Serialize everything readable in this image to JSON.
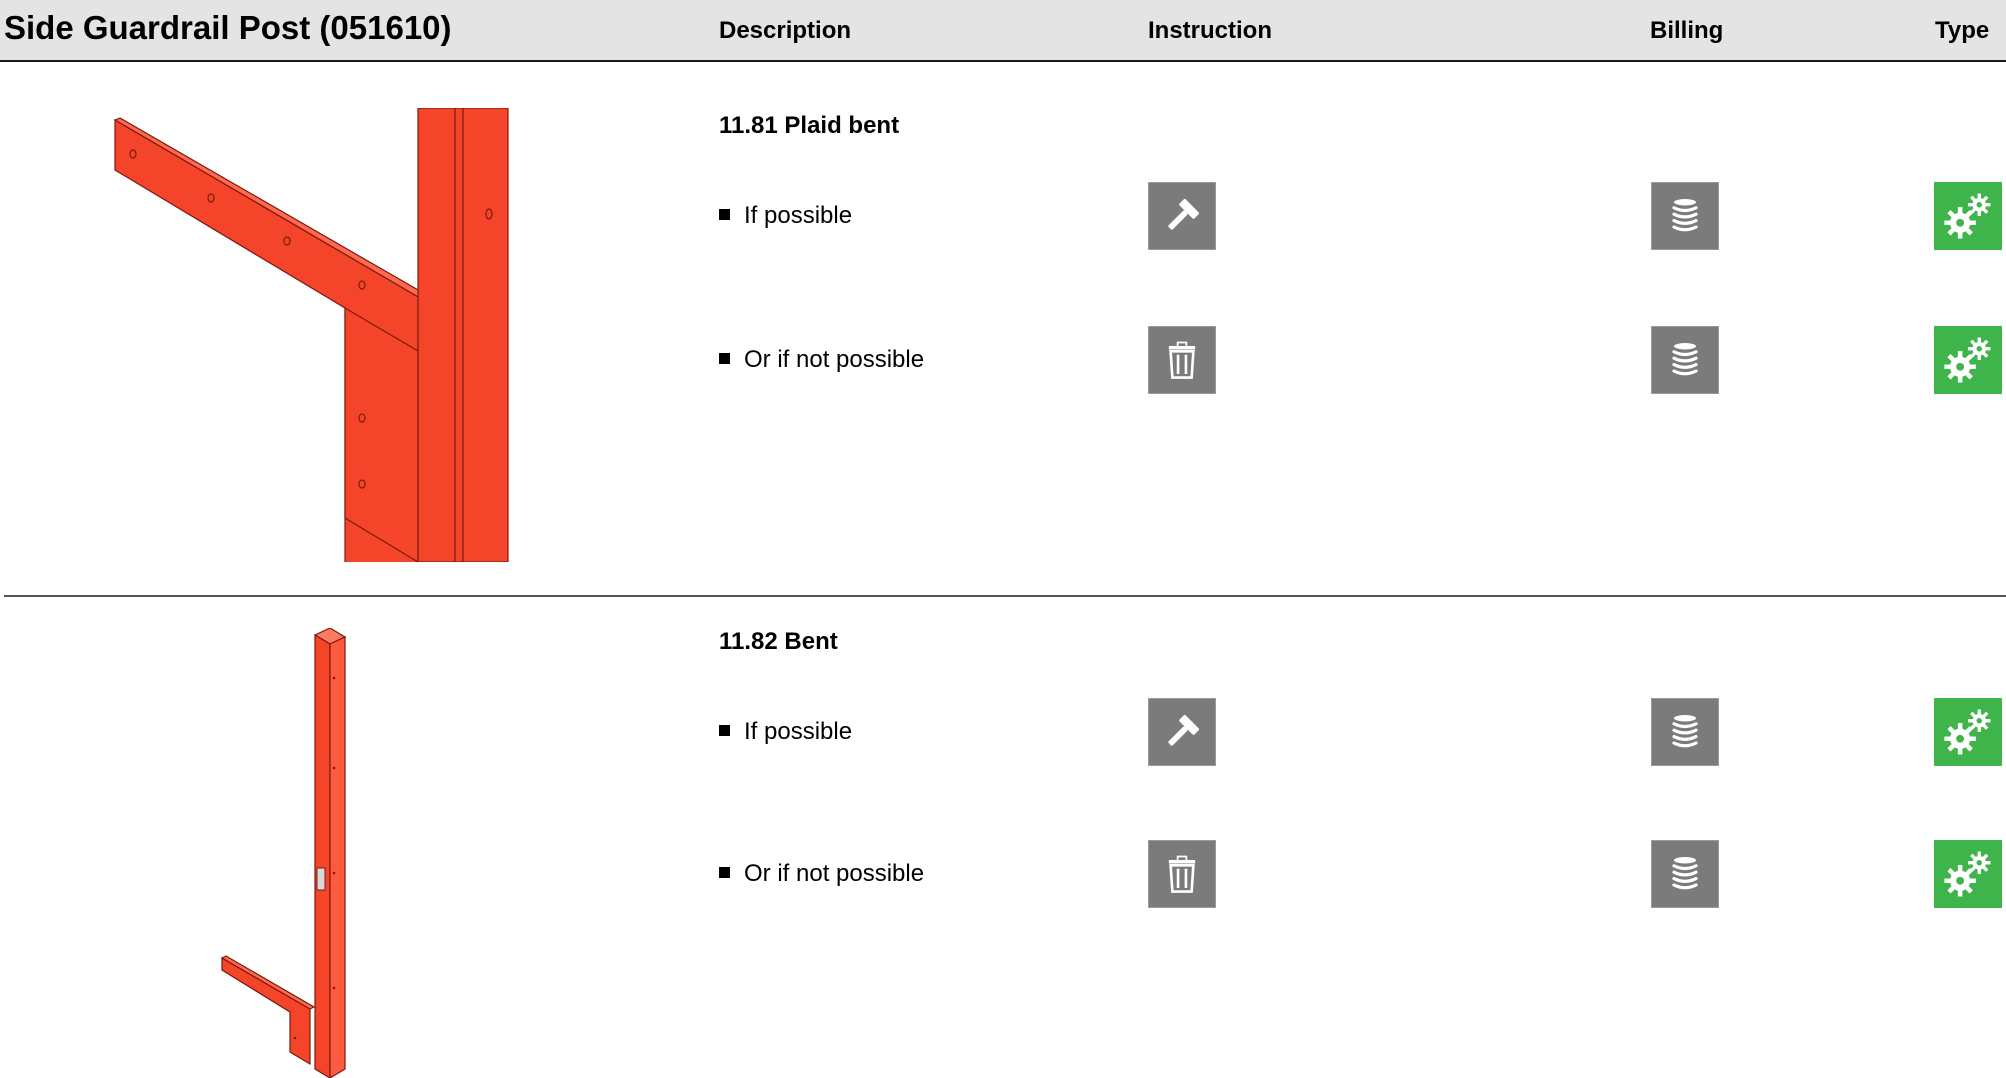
{
  "header": {
    "title": "Side Guardrail Post (051610)",
    "columns": {
      "description": "Description",
      "instruction": "Instruction",
      "billing": "Billing",
      "type": "Type"
    }
  },
  "colors": {
    "part": "#f4452a",
    "icon_gray": "#7b7b7b",
    "icon_green": "#3fb44a",
    "header_bg": "#e4e4e4"
  },
  "sections": [
    {
      "title": "11.81 Plaid bent",
      "rows": [
        {
          "label": "If possible",
          "instruction_icon": "hammer-icon",
          "billing_icon": "coin-stack-icon",
          "type_icon": "gears-icon"
        },
        {
          "label": "Or if not possible",
          "instruction_icon": "trash-icon",
          "billing_icon": "coin-stack-icon",
          "type_icon": "gears-icon"
        }
      ]
    },
    {
      "title": "11.82 Bent",
      "rows": [
        {
          "label": "If possible",
          "instruction_icon": "hammer-icon",
          "billing_icon": "coin-stack-icon",
          "type_icon": "gears-icon"
        },
        {
          "label": "Or if not possible",
          "instruction_icon": "trash-icon",
          "billing_icon": "coin-stack-icon",
          "type_icon": "gears-icon"
        }
      ]
    }
  ]
}
